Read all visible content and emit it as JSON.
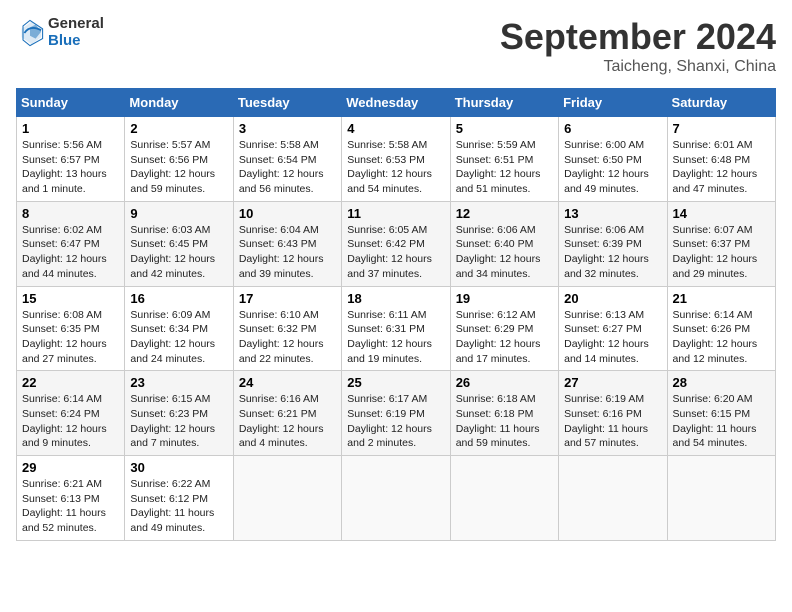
{
  "header": {
    "logo_line1": "General",
    "logo_line2": "Blue",
    "month": "September 2024",
    "location": "Taicheng, Shanxi, China"
  },
  "weekdays": [
    "Sunday",
    "Monday",
    "Tuesday",
    "Wednesday",
    "Thursday",
    "Friday",
    "Saturday"
  ],
  "weeks": [
    [
      {
        "day": "1",
        "info": "Sunrise: 5:56 AM\nSunset: 6:57 PM\nDaylight: 13 hours\nand 1 minute."
      },
      {
        "day": "2",
        "info": "Sunrise: 5:57 AM\nSunset: 6:56 PM\nDaylight: 12 hours\nand 59 minutes."
      },
      {
        "day": "3",
        "info": "Sunrise: 5:58 AM\nSunset: 6:54 PM\nDaylight: 12 hours\nand 56 minutes."
      },
      {
        "day": "4",
        "info": "Sunrise: 5:58 AM\nSunset: 6:53 PM\nDaylight: 12 hours\nand 54 minutes."
      },
      {
        "day": "5",
        "info": "Sunrise: 5:59 AM\nSunset: 6:51 PM\nDaylight: 12 hours\nand 51 minutes."
      },
      {
        "day": "6",
        "info": "Sunrise: 6:00 AM\nSunset: 6:50 PM\nDaylight: 12 hours\nand 49 minutes."
      },
      {
        "day": "7",
        "info": "Sunrise: 6:01 AM\nSunset: 6:48 PM\nDaylight: 12 hours\nand 47 minutes."
      }
    ],
    [
      {
        "day": "8",
        "info": "Sunrise: 6:02 AM\nSunset: 6:47 PM\nDaylight: 12 hours\nand 44 minutes."
      },
      {
        "day": "9",
        "info": "Sunrise: 6:03 AM\nSunset: 6:45 PM\nDaylight: 12 hours\nand 42 minutes."
      },
      {
        "day": "10",
        "info": "Sunrise: 6:04 AM\nSunset: 6:43 PM\nDaylight: 12 hours\nand 39 minutes."
      },
      {
        "day": "11",
        "info": "Sunrise: 6:05 AM\nSunset: 6:42 PM\nDaylight: 12 hours\nand 37 minutes."
      },
      {
        "day": "12",
        "info": "Sunrise: 6:06 AM\nSunset: 6:40 PM\nDaylight: 12 hours\nand 34 minutes."
      },
      {
        "day": "13",
        "info": "Sunrise: 6:06 AM\nSunset: 6:39 PM\nDaylight: 12 hours\nand 32 minutes."
      },
      {
        "day": "14",
        "info": "Sunrise: 6:07 AM\nSunset: 6:37 PM\nDaylight: 12 hours\nand 29 minutes."
      }
    ],
    [
      {
        "day": "15",
        "info": "Sunrise: 6:08 AM\nSunset: 6:35 PM\nDaylight: 12 hours\nand 27 minutes."
      },
      {
        "day": "16",
        "info": "Sunrise: 6:09 AM\nSunset: 6:34 PM\nDaylight: 12 hours\nand 24 minutes."
      },
      {
        "day": "17",
        "info": "Sunrise: 6:10 AM\nSunset: 6:32 PM\nDaylight: 12 hours\nand 22 minutes."
      },
      {
        "day": "18",
        "info": "Sunrise: 6:11 AM\nSunset: 6:31 PM\nDaylight: 12 hours\nand 19 minutes."
      },
      {
        "day": "19",
        "info": "Sunrise: 6:12 AM\nSunset: 6:29 PM\nDaylight: 12 hours\nand 17 minutes."
      },
      {
        "day": "20",
        "info": "Sunrise: 6:13 AM\nSunset: 6:27 PM\nDaylight: 12 hours\nand 14 minutes."
      },
      {
        "day": "21",
        "info": "Sunrise: 6:14 AM\nSunset: 6:26 PM\nDaylight: 12 hours\nand 12 minutes."
      }
    ],
    [
      {
        "day": "22",
        "info": "Sunrise: 6:14 AM\nSunset: 6:24 PM\nDaylight: 12 hours\nand 9 minutes."
      },
      {
        "day": "23",
        "info": "Sunrise: 6:15 AM\nSunset: 6:23 PM\nDaylight: 12 hours\nand 7 minutes."
      },
      {
        "day": "24",
        "info": "Sunrise: 6:16 AM\nSunset: 6:21 PM\nDaylight: 12 hours\nand 4 minutes."
      },
      {
        "day": "25",
        "info": "Sunrise: 6:17 AM\nSunset: 6:19 PM\nDaylight: 12 hours\nand 2 minutes."
      },
      {
        "day": "26",
        "info": "Sunrise: 6:18 AM\nSunset: 6:18 PM\nDaylight: 11 hours\nand 59 minutes."
      },
      {
        "day": "27",
        "info": "Sunrise: 6:19 AM\nSunset: 6:16 PM\nDaylight: 11 hours\nand 57 minutes."
      },
      {
        "day": "28",
        "info": "Sunrise: 6:20 AM\nSunset: 6:15 PM\nDaylight: 11 hours\nand 54 minutes."
      }
    ],
    [
      {
        "day": "29",
        "info": "Sunrise: 6:21 AM\nSunset: 6:13 PM\nDaylight: 11 hours\nand 52 minutes."
      },
      {
        "day": "30",
        "info": "Sunrise: 6:22 AM\nSunset: 6:12 PM\nDaylight: 11 hours\nand 49 minutes."
      },
      {
        "day": "",
        "info": ""
      },
      {
        "day": "",
        "info": ""
      },
      {
        "day": "",
        "info": ""
      },
      {
        "day": "",
        "info": ""
      },
      {
        "day": "",
        "info": ""
      }
    ]
  ]
}
